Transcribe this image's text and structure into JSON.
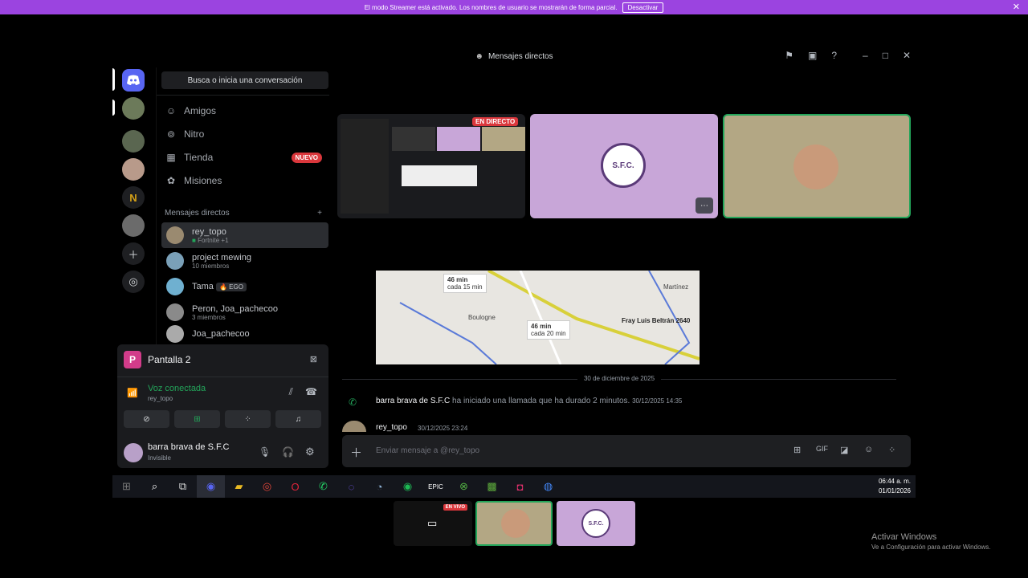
{
  "banner": {
    "text": "El modo Streamer está activado. Los nombres de usuario se mostrarán de forma parcial.",
    "button": "Desactivar"
  },
  "window": {
    "title": "Mensajes directos"
  },
  "sidebar": {
    "search_placeholder": "Busca o inicia una conversación",
    "nav": [
      {
        "label": "Amigos",
        "icon": "friends-icon"
      },
      {
        "label": "Nitro",
        "icon": "nitro-icon"
      },
      {
        "label": "Tienda",
        "icon": "shop-icon",
        "badge": "NUEVO"
      },
      {
        "label": "Misiones",
        "icon": "quests-icon"
      }
    ],
    "dm_header": "Mensajes directos",
    "dms": [
      {
        "name": "rey_topo",
        "sub": "Fortnite +1"
      },
      {
        "name": "project mewing",
        "sub": "10 miembros"
      },
      {
        "name": "Tama",
        "tag": "EGO"
      },
      {
        "name": "Peron, Joa_pachecoo",
        "sub": "3 miembros"
      },
      {
        "name": "Joa_pachecoo"
      }
    ]
  },
  "voice_panel": {
    "stream_title": "Pantalla 2",
    "status": "Voz conectada",
    "channel": "rey_topo"
  },
  "user": {
    "name": "barra brava de S.F.C",
    "status": "Invisible"
  },
  "stage": {
    "live_badge": "EN DIRECTO",
    "map_time_1": "46 min",
    "map_sub_1": "cada 15 min",
    "map_time_2": "46 min",
    "map_sub_2": "cada 20 min",
    "map_place": "Fray Luis Beltrán 2640",
    "map_boulogne": "Boulogne",
    "map_martinez": "Martínez"
  },
  "chat": {
    "date_divider": "30 de diciembre de 2025",
    "call_user": "barra brava de S.F.C",
    "call_text": "ha iniciado una llamada que ha durado 2 minutos.",
    "call_time": "30/12/2025 14:35",
    "msg_user": "rey_topo",
    "msg_time": "30/12/2025 23:24",
    "input_placeholder": "Enviar mensaje a @rey_topo"
  },
  "taskbar": {
    "time": "06:44 a. m.",
    "date": "01/01/2026"
  },
  "preview": {
    "live": "EN VIVO"
  },
  "watermark": {
    "title": "Activar Windows",
    "sub": "Ve a Configuración para activar Windows."
  },
  "colors": {
    "banner": "#9b44e0",
    "accent_green": "#23a55a",
    "tile_purple": "#c8a6d8",
    "tile_tan": "#b3a784",
    "red": "#da373c"
  }
}
